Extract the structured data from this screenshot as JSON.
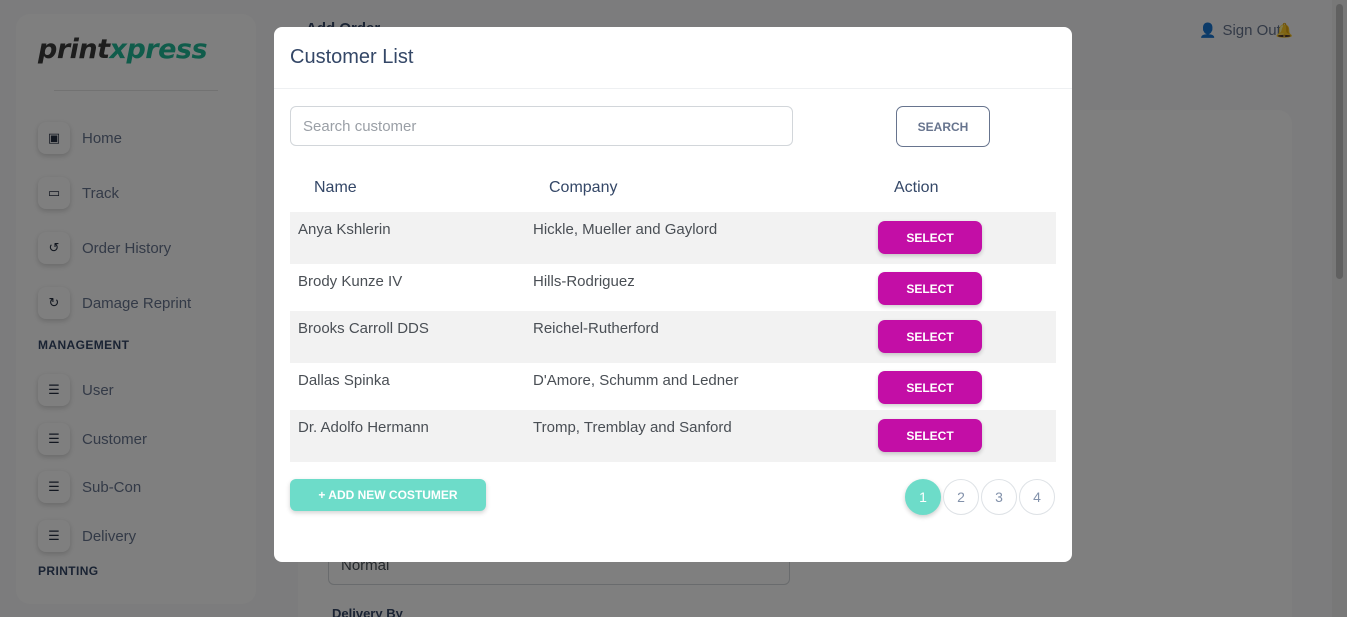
{
  "app": {
    "logo_part1": "print",
    "logo_part2": "xpress",
    "page_title": "Add Order"
  },
  "topbar": {
    "sign_out_label": "Sign Out!"
  },
  "sidebar": {
    "items": [
      {
        "label": "Home",
        "icon": "shop-icon"
      },
      {
        "label": "Track",
        "icon": "card-icon"
      },
      {
        "label": "Order History",
        "icon": "history-icon"
      },
      {
        "label": "Damage Reprint",
        "icon": "refresh-icon"
      }
    ],
    "management_heading": "MANAGEMENT",
    "management_items": [
      {
        "label": "User",
        "icon": "list-icon"
      },
      {
        "label": "Customer",
        "icon": "list-icon"
      },
      {
        "label": "Sub-Con",
        "icon": "list-icon"
      },
      {
        "label": "Delivery",
        "icon": "list-icon"
      }
    ],
    "printing_heading": "PRINTING"
  },
  "background_form": {
    "priority_value": "Normal",
    "delivery_label": "Delivery By"
  },
  "modal": {
    "title": "Customer List",
    "search": {
      "placeholder": "Search customer",
      "button_label": "SEARCH"
    },
    "table": {
      "headers": [
        "Name",
        "Company",
        "Action"
      ],
      "rows": [
        {
          "name": "Anya Kshlerin",
          "company": "Hickle, Mueller and Gaylord",
          "action": "SELECT"
        },
        {
          "name": "Brody Kunze IV",
          "company": "Hills-Rodriguez",
          "action": "SELECT"
        },
        {
          "name": "Brooks Carroll DDS",
          "company": "Reichel-Rutherford",
          "action": "SELECT"
        },
        {
          "name": "Dallas Spinka",
          "company": "D'Amore, Schumm and Ledner",
          "action": "SELECT"
        },
        {
          "name": "Dr. Adolfo Hermann",
          "company": "Tromp, Tremblay and Sanford",
          "action": "SELECT"
        }
      ]
    },
    "add_button_label": "+  ADD NEW COSTUMER",
    "pagination": {
      "pages": [
        "1",
        "2",
        "3",
        "4"
      ],
      "active_page": "1"
    }
  },
  "colors": {
    "accent_teal": "#6ddcc9",
    "select_magenta": "#c30ea6",
    "text_dark": "#344767"
  }
}
